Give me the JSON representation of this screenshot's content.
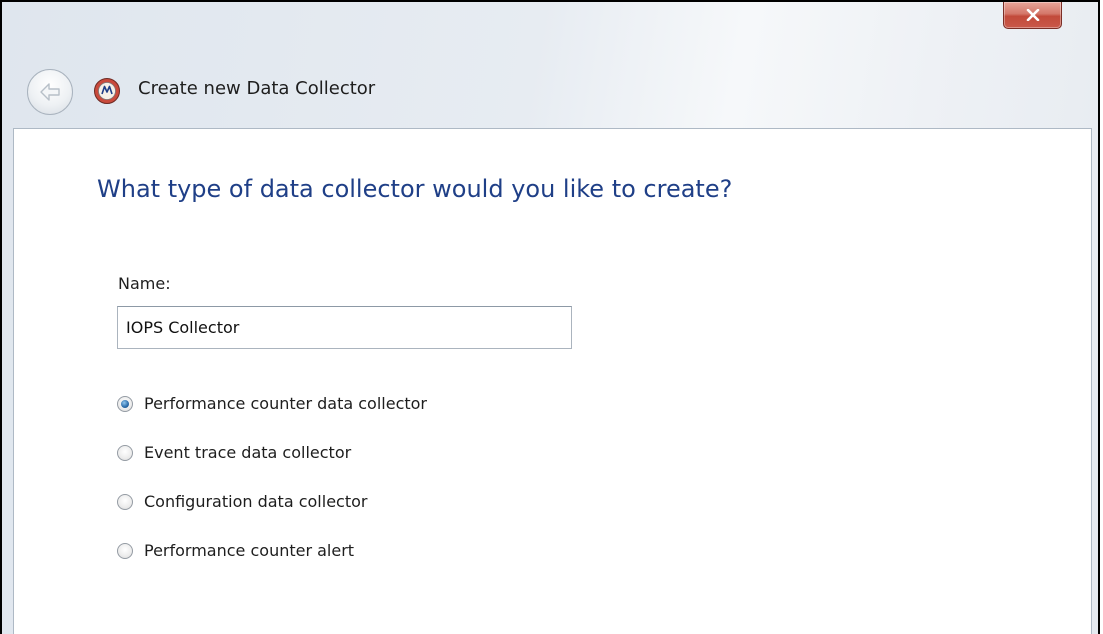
{
  "window": {
    "title": "Create new Data Collector"
  },
  "page": {
    "heading": "What type of data collector would you like to create?"
  },
  "form": {
    "name_label": "Name:",
    "name_value": "IOPS Collector",
    "options": [
      {
        "label": "Performance counter data collector",
        "selected": true
      },
      {
        "label": "Event trace data collector",
        "selected": false
      },
      {
        "label": "Configuration data collector",
        "selected": false
      },
      {
        "label": "Performance counter alert",
        "selected": false
      }
    ]
  },
  "colors": {
    "heading": "#1f3f87",
    "close_button": "#c24a3a",
    "selected_radio": "#2a6aa8"
  },
  "icons": {
    "close": "close-icon",
    "back": "back-arrow-icon",
    "app": "performance-monitor-icon"
  }
}
